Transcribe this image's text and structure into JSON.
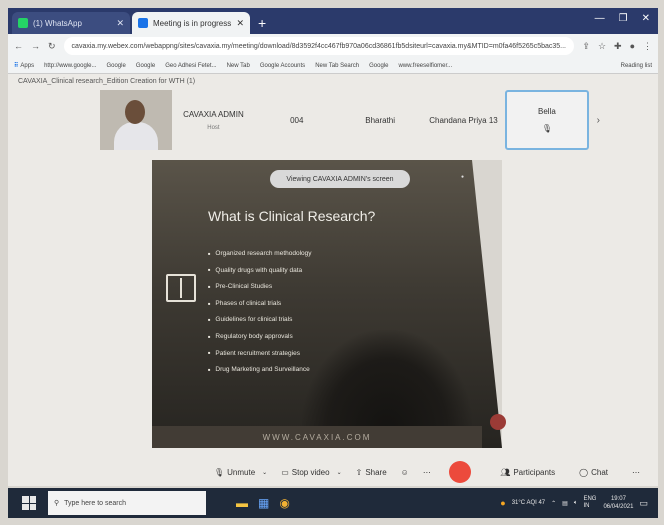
{
  "tabs": [
    {
      "title": "(1) WhatsApp",
      "icon": "whatsapp-icon",
      "color": "#25d366"
    },
    {
      "title": "Meeting is in progress",
      "icon": "webex-icon",
      "color": "#1a73e8"
    }
  ],
  "url": "cavaxia.my.webex.com/webappng/sites/cavaxia.my/meeting/download/8d3592f4cc467fb970a06cd36861fb5dsiteurl=cavaxia.my&MTID=m0fa46f5265c5bac35...",
  "bookmarks": [
    "Apps",
    "http://www.google...",
    "Google",
    "Google",
    "Geo Adhesi Fetet...",
    "New Tab",
    "Google Accounts",
    "New Tab Search",
    "Google",
    "www.freeselfiomer..."
  ],
  "reading_list": "Reading list",
  "filename": "CAVAXIA_Clinical research_Edition Creation for WTH (1)",
  "participants": [
    {
      "name": "CAVAXIA ADMIN",
      "role": "Host"
    },
    {
      "name": "004",
      "role": ""
    },
    {
      "name": "Bharathi",
      "role": ""
    },
    {
      "name": "Chandana Priya 13",
      "role": ""
    },
    {
      "name": "Bella",
      "role": ""
    }
  ],
  "share_banner": "Viewing CAVAXIA ADMIN's screen",
  "slide": {
    "title": "What is Clinical Research?",
    "bullets": [
      "Organized research methodology",
      "Quality drugs with quality data",
      "Pre-Clinical Studies",
      "Phases of clinical trials",
      "Guidelines for clinical trials",
      "Regulatory body approvals",
      "Patient recruitment strategies",
      "Drug Marketing and Surveillance"
    ],
    "footer": "WWW.CAVAXIA.COM"
  },
  "controls": {
    "unmute": "Unmute",
    "stop_video": "Stop video",
    "share": "Share",
    "participants": "Participants",
    "chat": "Chat"
  },
  "taskbar": {
    "search_placeholder": "Type here to search",
    "weather": "31°C AQI 47",
    "lang": "ENG IN",
    "time": "19:07",
    "date": "06/04/2021"
  }
}
